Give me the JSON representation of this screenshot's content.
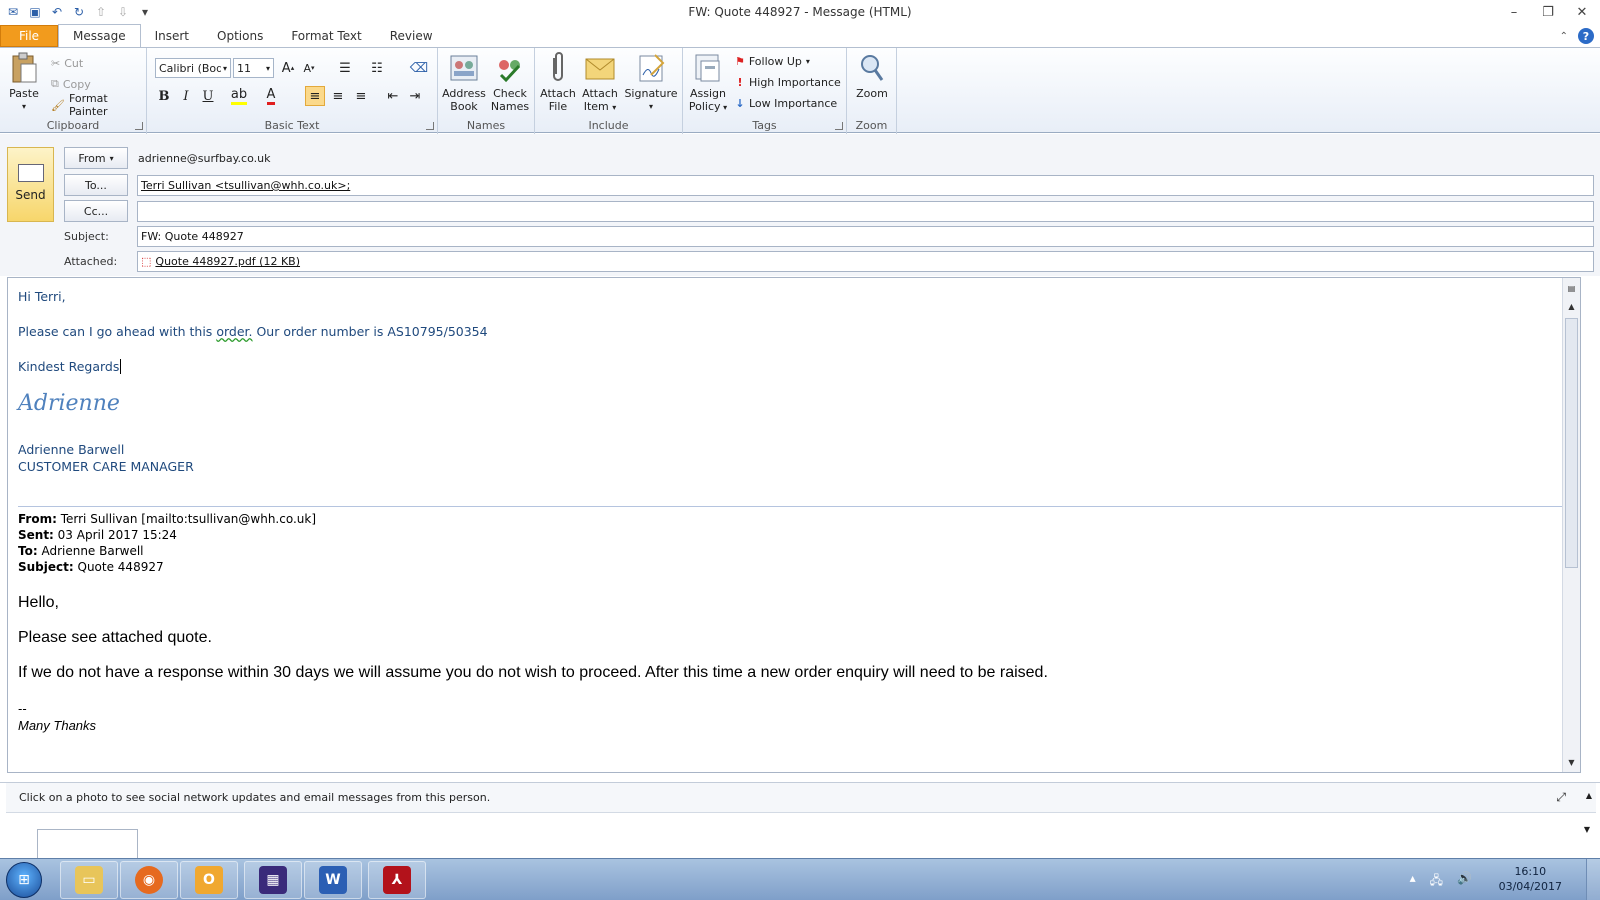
{
  "window": {
    "title": "FW: Quote 448927  -  Message (HTML)"
  },
  "tabs": [
    "File",
    "Message",
    "Insert",
    "Options",
    "Format Text",
    "Review"
  ],
  "ribbon": {
    "clipboard": {
      "paste": "Paste",
      "cut": "Cut",
      "copy": "Copy",
      "format_painter": "Format Painter",
      "label": "Clipboard"
    },
    "basic_text": {
      "font": "Calibri (Body)",
      "size": "11",
      "label": "Basic Text"
    },
    "names": {
      "address_book_1": "Address",
      "address_book_2": "Book",
      "check_names_1": "Check",
      "check_names_2": "Names",
      "label": "Names"
    },
    "include": {
      "attach_file_1": "Attach",
      "attach_file_2": "File",
      "attach_item_1": "Attach",
      "attach_item_2": "Item",
      "signature": "Signature",
      "label": "Include"
    },
    "tags": {
      "assign_policy_1": "Assign",
      "assign_policy_2": "Policy",
      "follow_up": "Follow Up",
      "high_importance": "High Importance",
      "low_importance": "Low Importance",
      "label": "Tags"
    },
    "zoom": {
      "zoom": "Zoom",
      "label": "Zoom"
    }
  },
  "header": {
    "send": "Send",
    "from_button": "From",
    "from_value": "adrienne@surfbay.co.uk",
    "to_button": "To...",
    "to_value": "Terri Sullivan <tsullivan@whh.co.uk>;",
    "cc_button": "Cc...",
    "cc_value": "",
    "subject_label": "Subject:",
    "subject_value": "FW: Quote 448927",
    "attached_label": "Attached:",
    "attachment": "Quote 448927.pdf (12 KB)"
  },
  "body": {
    "greeting": "Hi Terri,",
    "line1_a": "Please can I go ahead with this ",
    "line1_b": "order.",
    "line1_c": "  Our order number is AS10795/50354",
    "regards": "Kindest Regards",
    "script_sig": "Adrienne",
    "sig_name": "Adrienne Barwell",
    "sig_title": "CUSTOMER CARE MANAGER",
    "fwd_from_label": "From:",
    "fwd_from": " Terri Sullivan [mailto:tsullivan@whh.co.uk]",
    "fwd_sent_label": "Sent:",
    "fwd_sent": " 03 April 2017 15:24",
    "fwd_to_label": "To:",
    "fwd_to": " Adrienne Barwell",
    "fwd_subject_label": "Subject:",
    "fwd_subject": " Quote 448927",
    "hello": "Hello,",
    "see_attached": "Please see attached quote.",
    "response_line": "If we do not have a response within 30 days we will assume you do not wish to proceed. After this time a new order enquiry will need to be raised.",
    "dashes": "--",
    "many_thanks": "Many Thanks"
  },
  "people_pane": {
    "message": "Click on a photo to see social network updates and email messages from this person."
  },
  "taskbar": {
    "time": "16:10",
    "date": "03/04/2017"
  }
}
